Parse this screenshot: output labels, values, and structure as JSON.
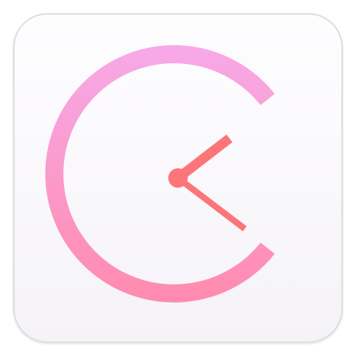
{
  "icon": {
    "name": "clock-app-icon",
    "colors": {
      "tile_top": "#fefdfe",
      "tile_bottom": "#f5f3f8",
      "tile_border": "#dcdcdc",
      "ring_top": "#f7a8e6",
      "ring_bottom": "#ff8cb0",
      "hands": "#fb7579"
    }
  }
}
